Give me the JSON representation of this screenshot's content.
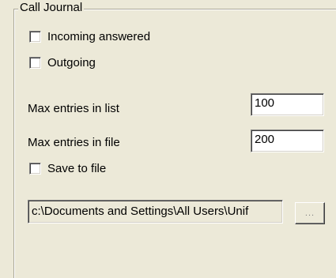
{
  "group": {
    "title": "Call Journal"
  },
  "options": {
    "incoming_answered": {
      "label": "Incoming answered",
      "checked": false
    },
    "outgoing": {
      "label": "Outgoing",
      "checked": false
    },
    "save_to_file": {
      "label": "Save to file",
      "checked": false
    }
  },
  "fields": {
    "max_entries_list": {
      "label": "Max entries in list",
      "value": "100"
    },
    "max_entries_file": {
      "label": "Max entries in file",
      "value": "200"
    },
    "file_path": {
      "value": "c:\\Documents and Settings\\All Users\\Unif"
    }
  },
  "browse_button": {
    "label": "..."
  }
}
